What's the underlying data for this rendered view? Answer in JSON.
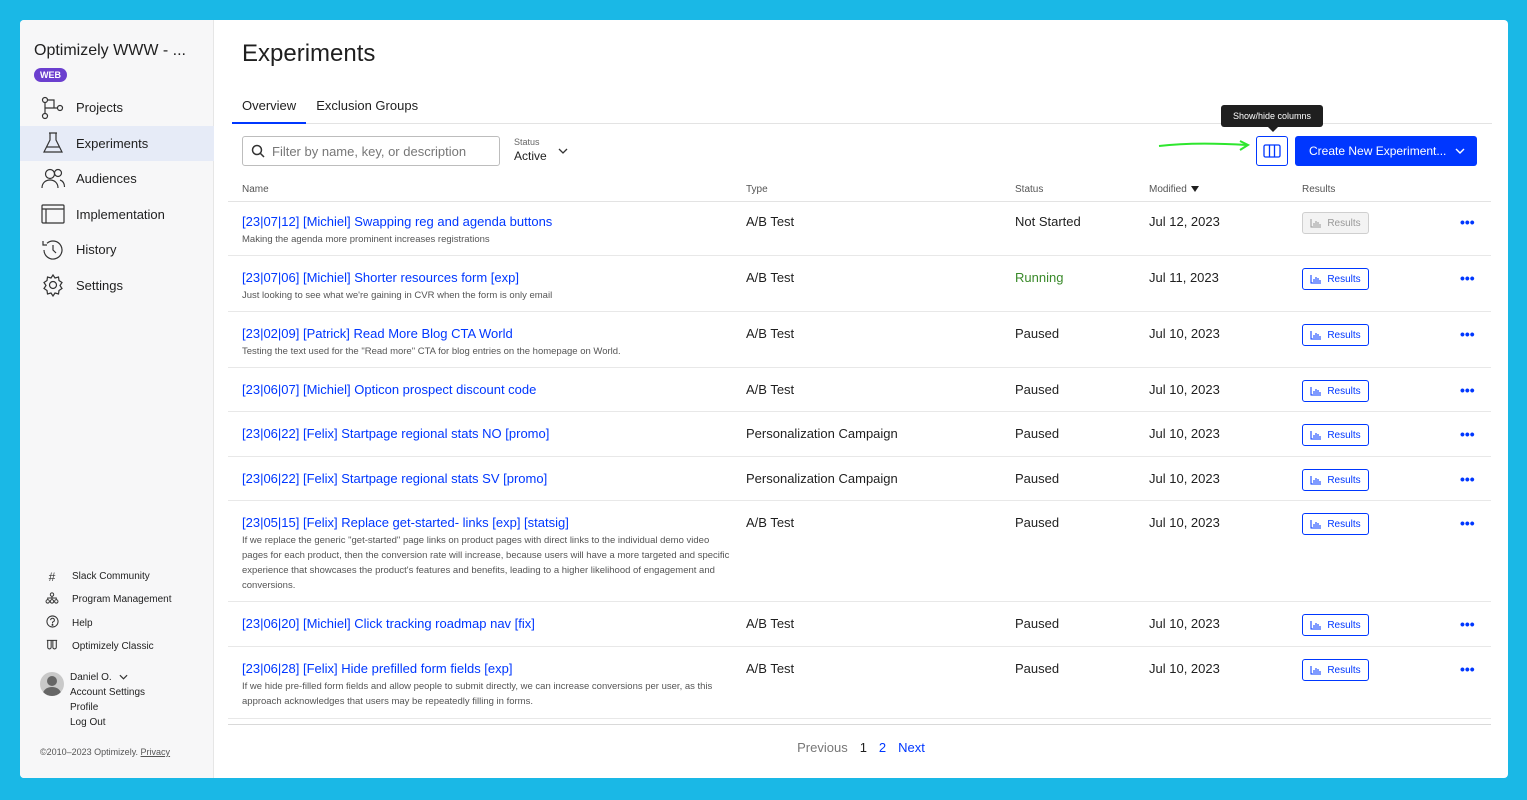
{
  "sidebar": {
    "project_title": "Optimizely WWW - ...",
    "project_badge": "WEB",
    "nav": [
      {
        "label": "Projects",
        "icon": "projects-icon"
      },
      {
        "label": "Experiments",
        "icon": "flask-icon",
        "active": true
      },
      {
        "label": "Audiences",
        "icon": "users-icon"
      },
      {
        "label": "Implementation",
        "icon": "window-icon"
      },
      {
        "label": "History",
        "icon": "history-icon"
      },
      {
        "label": "Settings",
        "icon": "gear-icon"
      }
    ],
    "bottom_links": [
      {
        "label": "Slack Community",
        "icon": "hash-icon"
      },
      {
        "label": "Program Management",
        "icon": "org-chart-icon"
      },
      {
        "label": "Help",
        "icon": "help-icon"
      },
      {
        "label": "Optimizely Classic",
        "icon": "classic-icon"
      }
    ],
    "user": {
      "name": "Daniel O.",
      "links": [
        "Account Settings",
        "Profile",
        "Log Out"
      ]
    },
    "copyright": "©2010–2023 Optimizely.",
    "privacy_label": "Privacy"
  },
  "main": {
    "title": "Experiments",
    "tabs": [
      {
        "label": "Overview",
        "active": true
      },
      {
        "label": "Exclusion Groups",
        "active": false
      }
    ],
    "search": {
      "placeholder": "Filter by name, key, or description",
      "value": ""
    },
    "status_filter": {
      "label": "Status",
      "value": "Active"
    },
    "tooltip": "Show/hide columns",
    "create_button": "Create New Experiment...",
    "accent_color": "#0037ff",
    "columns": {
      "name": "Name",
      "type": "Type",
      "status": "Status",
      "modified": "Modified",
      "results": "Results"
    },
    "rows": [
      {
        "name": "[23|07|12] [Michiel] Swapping reg and agenda buttons",
        "desc": "Making the agenda more prominent increases registrations",
        "type": "A/B Test",
        "status": "Not Started",
        "modified": "Jul 12, 2023",
        "results": "Results",
        "results_enabled": false
      },
      {
        "name": "[23|07|06] [Michiel] Shorter resources form [exp]",
        "desc": "Just looking to see what we're gaining in CVR when the form is only email",
        "type": "A/B Test",
        "status": "Running",
        "modified": "Jul 11, 2023",
        "results": "Results",
        "results_enabled": true
      },
      {
        "name": "[23|02|09] [Patrick] Read More Blog CTA World",
        "desc": "Testing the text used for the \"Read more\" CTA for blog entries on the homepage on World.",
        "type": "A/B Test",
        "status": "Paused",
        "modified": "Jul 10, 2023",
        "results": "Results",
        "results_enabled": true
      },
      {
        "name": "[23|06|07] [Michiel] Opticon prospect discount code",
        "desc": "",
        "type": "A/B Test",
        "status": "Paused",
        "modified": "Jul 10, 2023",
        "results": "Results",
        "results_enabled": true
      },
      {
        "name": "[23|06|22] [Felix] Startpage regional stats NO [promo]",
        "desc": "",
        "type": "Personalization Campaign",
        "status": "Paused",
        "modified": "Jul 10, 2023",
        "results": "Results",
        "results_enabled": true
      },
      {
        "name": "[23|06|22] [Felix] Startpage regional stats SV [promo]",
        "desc": "",
        "type": "Personalization Campaign",
        "status": "Paused",
        "modified": "Jul 10, 2023",
        "results": "Results",
        "results_enabled": true
      },
      {
        "name": "[23|05|15] [Felix] Replace get-started- links [exp] [statsig]",
        "desc": "If we replace the generic \"get-started\" page links on product pages with direct links to the individual demo video pages for each product, then the conversion rate will increase, because users will have a more targeted and specific experience that showcases the product's features and benefits, leading to a higher likelihood of engagement and conversions.",
        "type": "A/B Test",
        "status": "Paused",
        "modified": "Jul 10, 2023",
        "results": "Results",
        "results_enabled": true
      },
      {
        "name": "[23|06|20] [Michiel] Click tracking roadmap nav [fix]",
        "desc": "",
        "type": "A/B Test",
        "status": "Paused",
        "modified": "Jul 10, 2023",
        "results": "Results",
        "results_enabled": true
      },
      {
        "name": "[23|06|28] [Felix] Hide prefilled form fields [exp]",
        "desc": "If we hide pre-filled form fields and allow people to submit directly, we can increase conversions per user, as this approach acknowledges that users may be repeatedly filling in forms.",
        "type": "A/B Test",
        "status": "Paused",
        "modified": "Jul 10, 2023",
        "results": "Results",
        "results_enabled": true
      }
    ],
    "more_label": "•••",
    "pagination": {
      "previous": "Previous",
      "pages": [
        "1",
        "2"
      ],
      "current": "1",
      "next": "Next"
    }
  }
}
